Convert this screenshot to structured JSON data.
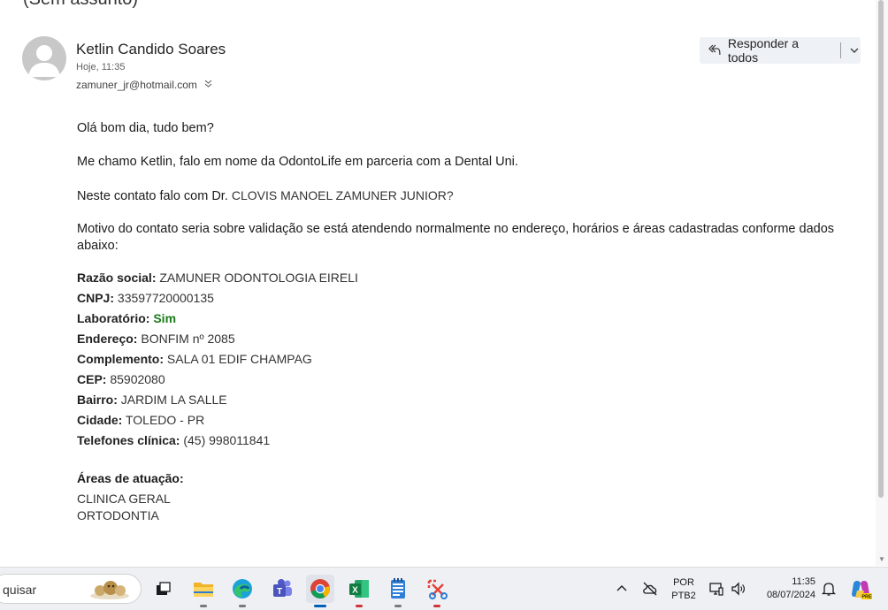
{
  "subject": "(Sem assunto)",
  "sender": {
    "name": "Ketlin Candido Soares",
    "time": "Hoje, 11:35",
    "email": "zamuner_jr@hotmail.com"
  },
  "actions": {
    "reply_all": "Responder a todos"
  },
  "body": {
    "greeting": "Olá bom dia, tudo bem?",
    "intro": "Me chamo Ketlin, falo em nome da OdontoLife em parceria com a Dental Uni.",
    "contact_prefix": "Neste contato falo com Dr. ",
    "contact_name": "CLOVIS MANOEL ZAMUNER JUNIOR?",
    "reason": "Motivo do contato seria sobre validação se está atendendo normalmente no endereço, horários e áreas cadastradas conforme dados abaixo:",
    "fields": [
      {
        "label": "Razão social:",
        "value": "ZAMUNER ODONTOLOGIA EIRELI"
      },
      {
        "label": "CNPJ:",
        "value": "33597720000135"
      },
      {
        "label": "Laboratório:",
        "value": "Sim",
        "highlight": true
      },
      {
        "label": "Endereço:",
        "value": "BONFIM nº 2085"
      },
      {
        "label": "Complemento:",
        "value": "SALA 01 EDIF CHAMPAG"
      },
      {
        "label": "CEP:",
        "value": "85902080"
      },
      {
        "label": "Bairro:",
        "value": "JARDIM LA SALLE"
      },
      {
        "label": "Cidade:",
        "value": "TOLEDO - PR"
      },
      {
        "label": "Telefones clínica:",
        "value": "(45) 998011841"
      }
    ],
    "areas_title": "Áreas de atuação:",
    "areas": [
      "CLINICA GERAL",
      "ORTODONTIA"
    ]
  },
  "taskbar": {
    "search_text": "quisar",
    "apps": [
      "task-view",
      "file-explorer",
      "edge",
      "teams",
      "chrome",
      "excel",
      "notepad",
      "snipping-tool"
    ],
    "language": "POR",
    "keyboard": "PTB2",
    "time": "11:35",
    "date": "08/07/2024"
  },
  "colors": {
    "laboratorio_value": "#1a7a1a",
    "reply_bg": "#eef1f6",
    "taskbar_bg": "#eef0f4"
  }
}
